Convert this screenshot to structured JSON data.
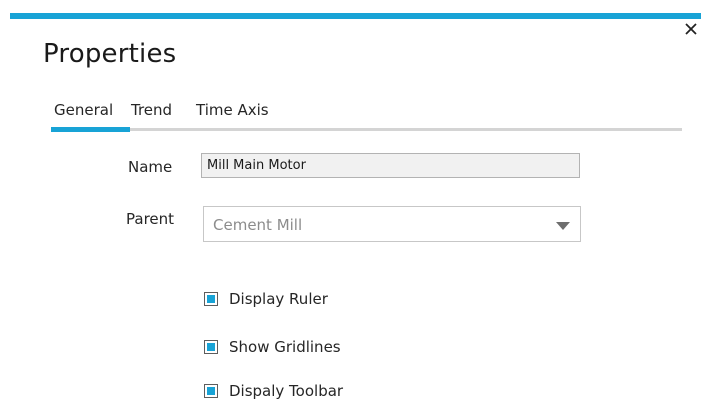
{
  "dialog": {
    "title": "Properties",
    "accent_color": "#18a3d6",
    "close_icon": "close-icon"
  },
  "tabs": [
    {
      "label": "General",
      "active": true
    },
    {
      "label": "Trend",
      "active": false
    },
    {
      "label": "Time Axis",
      "active": false
    }
  ],
  "form": {
    "name_label": "Name",
    "name_value": "Mill Main Motor",
    "parent_label": "Parent",
    "parent_value": "Cement Mill",
    "parent_dropdown_icon": "chevron-down-icon"
  },
  "options": [
    {
      "label": "Display Ruler",
      "checked": true
    },
    {
      "label": "Show Gridlines",
      "checked": true
    },
    {
      "label": "Dispaly Toolbar",
      "checked": true
    }
  ]
}
